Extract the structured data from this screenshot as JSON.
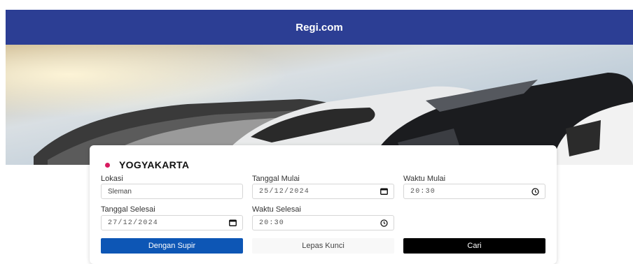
{
  "header": {
    "title": "Regi.com"
  },
  "brand": {
    "name": "YOGYAKARTA"
  },
  "form": {
    "lokasi": {
      "label": "Lokasi",
      "value": "Sleman"
    },
    "tanggal_mulai": {
      "label": "Tanggal Mulai",
      "value": "25/12/2024"
    },
    "waktu_mulai": {
      "label": "Waktu Mulai",
      "value": "20:30"
    },
    "tanggal_selesai": {
      "label": "Tanggal Selesai",
      "value": "27/12/2024"
    },
    "waktu_selesai": {
      "label": "Waktu Selesai",
      "value": "20:30"
    }
  },
  "buttons": {
    "dengan_supir": "Dengan Supir",
    "lepas_kunci": "Lepas Kunci",
    "cari": "Cari"
  },
  "icons": {
    "brand": "pink-dot-icon",
    "date": "calendar-icon",
    "time": "clock-icon"
  },
  "colors": {
    "header": "#2c3e94",
    "primary_button": "#0d56b5",
    "search_button": "#000000",
    "brand_dot": "#d81b60"
  }
}
